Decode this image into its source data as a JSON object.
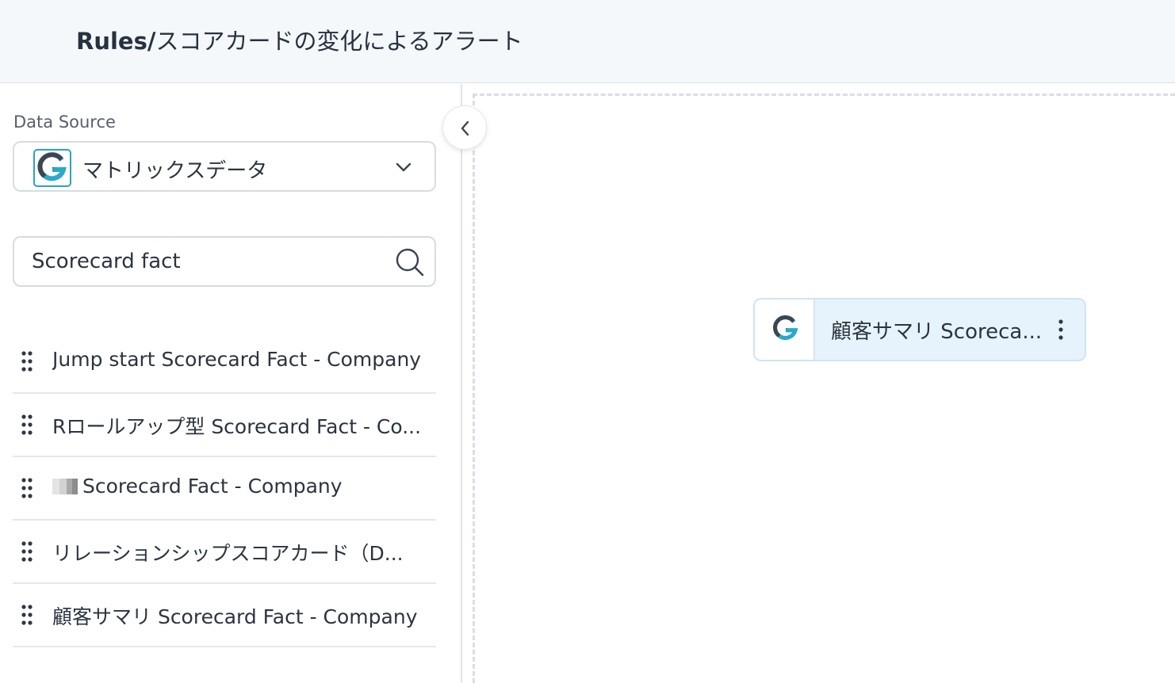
{
  "header": {
    "title_bold": "Rules/",
    "title_rest": "スコアカードの変化によるアラート"
  },
  "sidebar": {
    "data_source_label": "Data Source",
    "data_source_value": "マトリックスデータ",
    "search_value": "Scorecard fact",
    "items": [
      {
        "label": "Jump start Scorecard Fact - Company"
      },
      {
        "label": "Rロールアップ型 Scorecard Fact - Co..."
      },
      {
        "label": "Scorecard Fact - Company"
      },
      {
        "label": "リレーションシップスコアカード（D..."
      },
      {
        "label": "顧客サマリ Scorecard Fact - Company"
      }
    ]
  },
  "canvas": {
    "node": {
      "label": "顧客サマリ Scoreca..."
    }
  },
  "icons": {
    "logo": "g-logo-icon",
    "dropdown": "chevron-down-icon",
    "search": "search-icon",
    "drag": "drag-handle-icon",
    "collapse": "chevron-left-icon",
    "more": "more-vertical-icon"
  },
  "colors": {
    "accent": "#29a3c4",
    "node_bg": "#e7f3fc",
    "header_bg": "#f5f8fb"
  }
}
